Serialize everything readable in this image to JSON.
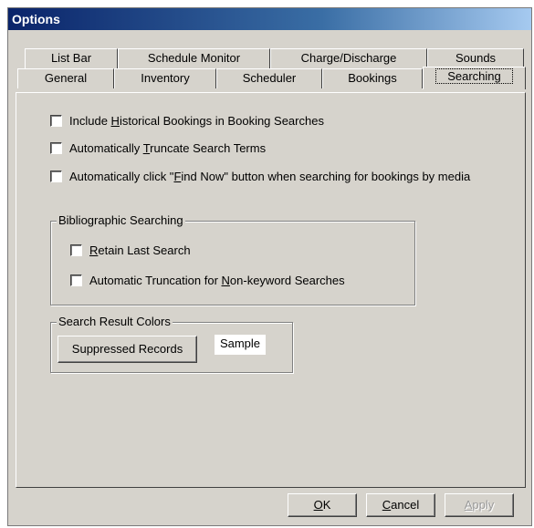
{
  "window": {
    "title": "Options"
  },
  "tabs_row1": [
    "List Bar",
    "Schedule Monitor",
    "Charge/Discharge",
    "Sounds"
  ],
  "tabs_row2": [
    "General",
    "Inventory",
    "Scheduler",
    "Bookings",
    "Searching"
  ],
  "active_tab": "Searching",
  "options": {
    "include_historical": {
      "pre": "Include ",
      "ul": "H",
      "post": "istorical Bookings in Booking Searches",
      "checked": false
    },
    "auto_truncate": {
      "pre": "Automatically ",
      "ul": "T",
      "post": "runcate Search Terms",
      "checked": false
    },
    "auto_find_now": {
      "pre": "Automatically click \"",
      "ul": "F",
      "post": "ind Now\" button when searching for bookings by media",
      "checked": false
    }
  },
  "biblio": {
    "legend": "Bibliographic Searching",
    "retain_last": {
      "pre": "",
      "ul": "R",
      "post": "etain Last Search",
      "checked": false
    },
    "auto_truncation": {
      "pre": "Automatic Truncation for ",
      "ul": "N",
      "post": "on-keyword Searches",
      "checked": false
    }
  },
  "colors": {
    "legend": "Search Result Colors",
    "suppressed_button": "Suppressed Records",
    "sample": "Sample"
  },
  "buttons": {
    "ok": {
      "ul": "O",
      "post": "K"
    },
    "cancel": {
      "ul": "C",
      "post": "ancel"
    },
    "apply": {
      "ul": "A",
      "post": "pply"
    }
  }
}
